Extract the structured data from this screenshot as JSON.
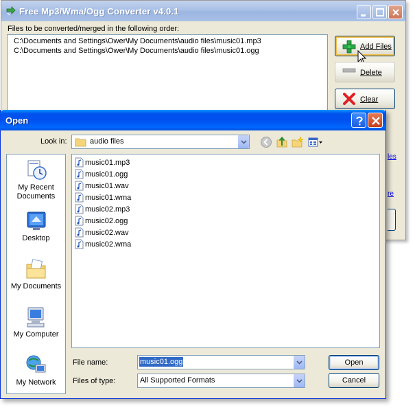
{
  "main_window": {
    "title": "Free Mp3/Wma/Ogg Converter v4.0.1",
    "files_label": "Files to be converted/merged in the following order:",
    "files": [
      "C:\\Documents and Settings\\Ower\\My Documents\\audio files\\music01.mp3",
      "C:\\Documents and Settings\\Ower\\My Documents\\audio files\\music01.ogg"
    ],
    "buttons": {
      "add_files": "Add Files",
      "delete": "Delete",
      "clear": "Clear"
    },
    "partial_link_1": "les",
    "partial_link_2": "re"
  },
  "open_dialog": {
    "title": "Open",
    "look_in_label": "Look in:",
    "look_in_value": "audio files",
    "places": [
      {
        "label": "My Recent Documents",
        "icon": "recent-documents-icon"
      },
      {
        "label": "Desktop",
        "icon": "desktop-icon"
      },
      {
        "label": "My Documents",
        "icon": "my-documents-icon"
      },
      {
        "label": "My Computer",
        "icon": "my-computer-icon"
      },
      {
        "label": "My Network",
        "icon": "my-network-icon"
      }
    ],
    "files": [
      "music01.mp3",
      "music01.ogg",
      "music01.wav",
      "music01.wma",
      "music02.mp3",
      "music02.ogg",
      "music02.wav",
      "music02.wma"
    ],
    "file_name_label": "File name:",
    "file_name_value": "music01.ogg",
    "files_of_type_label": "Files of type:",
    "files_of_type_value": "All Supported Formats",
    "open_button": "Open",
    "cancel_button": "Cancel"
  },
  "colors": {
    "dialog_title_blue": "#0053ee",
    "selection_blue": "#316ac5",
    "face": "#ece9d8"
  }
}
